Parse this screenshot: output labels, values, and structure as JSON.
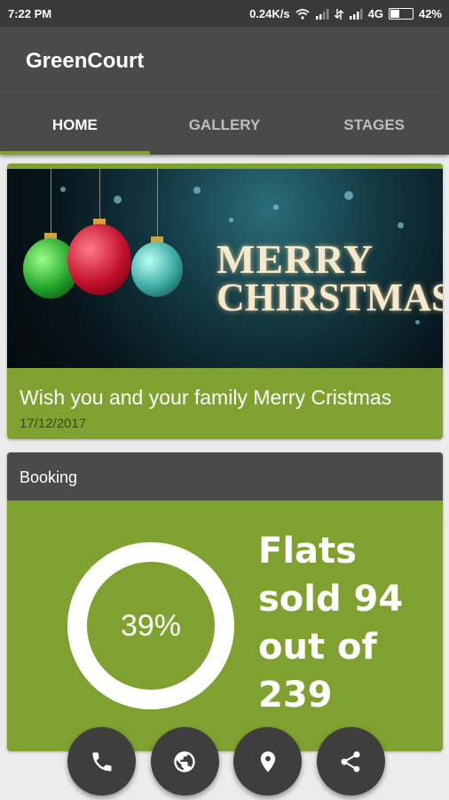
{
  "status_bar": {
    "time": "7:22 PM",
    "network_speed": "0.24K/s",
    "network_type": "4G",
    "battery": "42%"
  },
  "app": {
    "title": "GreenCourt"
  },
  "tabs": [
    {
      "label": "HOME",
      "active": true
    },
    {
      "label": "GALLERY",
      "active": false
    },
    {
      "label": "STAGES",
      "active": false
    }
  ],
  "banner": {
    "image_text_line1": "MERRY",
    "image_text_line2": "CHIRSTMAS",
    "caption": "Wish you and your family Merry Cristmas",
    "date": "17/12/2017"
  },
  "booking": {
    "header": "Booking",
    "percent": "39%",
    "flats_line1": "Flats",
    "flats_line2": "sold 94",
    "flats_line3": "out of",
    "flats_line4": "239"
  },
  "fabs": [
    {
      "icon": "phone-icon"
    },
    {
      "icon": "globe-icon"
    },
    {
      "icon": "location-pin-icon"
    },
    {
      "icon": "share-icon"
    }
  ],
  "colors": {
    "accent": "#7ea12f",
    "bar": "#4a4a4a",
    "status": "#3a3a3a"
  }
}
